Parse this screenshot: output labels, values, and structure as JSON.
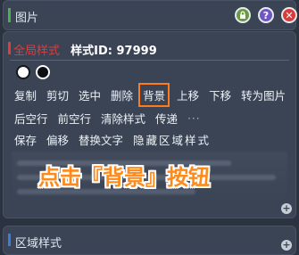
{
  "top_panel": {
    "title": "图片"
  },
  "main": {
    "global_label": "全局样式",
    "style_id": "样式ID: 97999",
    "row1": [
      "复制",
      "剪切",
      "选中",
      "删除",
      "背景",
      "上移",
      "下移",
      "转为图片"
    ],
    "row2": [
      "后空行",
      "前空行",
      "清除样式",
      "传递"
    ],
    "row2_more": "···",
    "row3": [
      "保存",
      "偏移",
      "替换文字",
      "隐藏区域样式"
    ],
    "highlighted_action": "背景"
  },
  "callout": {
    "text": "点击『背景』按钮"
  },
  "bottom_panel": {
    "title": "区域样式"
  },
  "icons": {
    "lock": "lock-icon",
    "help": "help-icon",
    "close": "close-icon",
    "expand": "plus-icon"
  },
  "colors": {
    "background": "#2b3340",
    "panel": "#3a4455",
    "accent_green": "#4caf50",
    "accent_blue": "#3d7be0",
    "global_red": "#e23b3b",
    "highlight_orange": "#ff7a1a",
    "callout_orange": "#ff8a1c"
  }
}
